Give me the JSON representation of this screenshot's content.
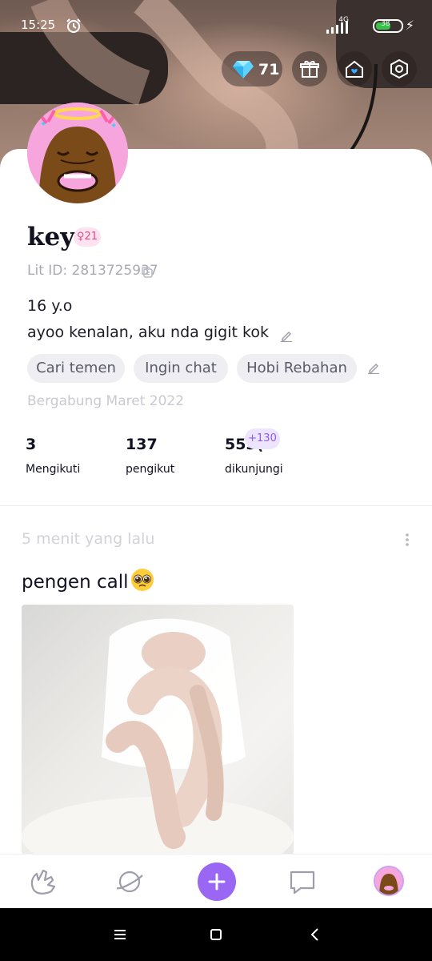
{
  "status_bar": {
    "time": "15:25",
    "network": "4G",
    "battery": "38"
  },
  "header": {
    "diamond_count": "71"
  },
  "profile": {
    "name": "key",
    "age_badge": "♀21",
    "lit_id": "Lit ID: 2813725937",
    "bio_line1": "16 y.o",
    "bio_line2": "ayoo kenalan, aku nda gigit kok",
    "tags": [
      "Cari temen",
      "Ingin chat",
      "Hobi Rebahan"
    ],
    "joined": "Bergabung Maret 2022",
    "stats": [
      {
        "value": "3",
        "label": "Mengikuti"
      },
      {
        "value": "137",
        "label": "pengikut"
      },
      {
        "value": "553(",
        "label": "dikunjungi"
      }
    ],
    "visit_badge": "+130"
  },
  "post": {
    "time": "5 menit yang lalu",
    "text": "pengen call"
  },
  "colors": {
    "accent": "#9a67f4",
    "badge_pink": "#e24b8b",
    "tag_bg": "#eeeef3"
  },
  "icons": {
    "gift": "gift-icon",
    "home": "home-heart-icon",
    "settings": "hexagon-settings-icon",
    "diamond": "diamond-icon"
  }
}
